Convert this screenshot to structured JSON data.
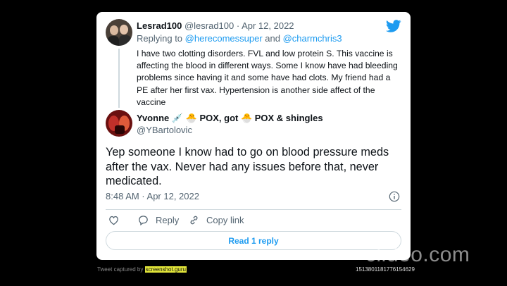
{
  "tweet_reply_to": {
    "display_name": "Lesrad100",
    "handle": "@lesrad100",
    "separator": " · ",
    "date": "Apr 12, 2022",
    "replying_prefix": "Replying to ",
    "replying_handle_1": "@herecomessuper",
    "replying_and": " and ",
    "replying_handle_2": "@charmchris3",
    "text": "I have two clotting disorders. FVL and low protein S.  This vaccine is affecting the blood in different ways. Some I know have had bleeding problems since having it and some have had clots. My friend had a PE after her first vax. Hypertension is another side affect of the vaccine"
  },
  "tweet_main": {
    "display_name": "Yvonne 💉 🐣 POX, got 🐣 POX & shingles",
    "handle": "@YBartolovic",
    "text": "Yep someone I know had to go on blood pressure meds after the vax. Never had any issues before that, never medicated.",
    "timestamp": "8:48 AM · Apr 12, 2022"
  },
  "actions": {
    "reply_label": "Reply",
    "copy_link_label": "Copy link"
  },
  "read_replies_label": "Read 1 reply",
  "footer": {
    "captured_prefix": "Tweet captured by ",
    "captured_site": "screenshot.guru",
    "tweet_id": "1513801181776154629"
  },
  "watermark": "clideo.com",
  "icons": {
    "brand": "twitter-bird-icon",
    "heart": "heart-icon",
    "reply": "reply-bubble-icon",
    "link": "link-icon",
    "info": "info-icon"
  },
  "colors": {
    "accent": "#1d9bf0",
    "text": "#0f1419",
    "muted": "#536471",
    "border": "#cfd9de",
    "background": "#000000"
  }
}
